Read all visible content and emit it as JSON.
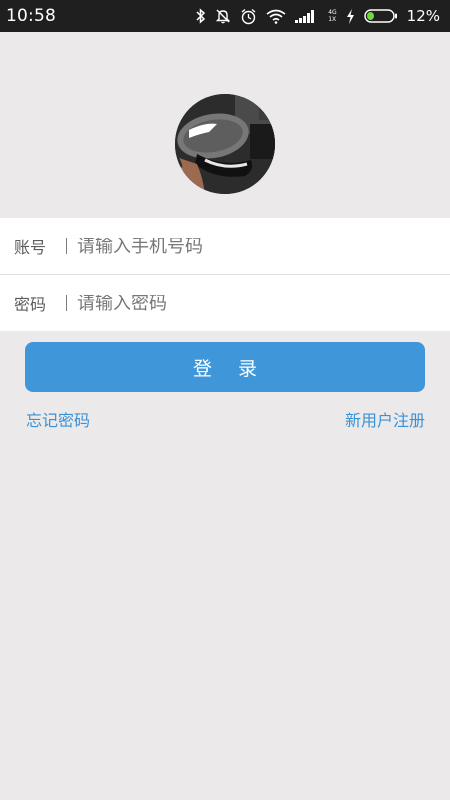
{
  "status_bar": {
    "time": "10:58",
    "network_top": "4G",
    "network_bottom": "1X",
    "battery_percent": "12%",
    "icons": [
      "bluetooth-icon",
      "mute-icon",
      "alarm-icon",
      "wifi-icon",
      "signal-icon",
      "charging-icon",
      "battery-icon"
    ]
  },
  "avatar": {
    "description_icon": "avatar-shoe-photo"
  },
  "form": {
    "account_label": "账号",
    "account_placeholder": "请输入手机号码",
    "password_label": "密码",
    "password_placeholder": "请输入密码"
  },
  "actions": {
    "login_label": "登 录",
    "forgot_label": "忘记密码",
    "register_label": "新用户注册"
  },
  "colors": {
    "background": "#ebe9ea",
    "status_bar": "#1f1f1f",
    "primary": "#3f97d9",
    "link": "#3a92d6"
  }
}
